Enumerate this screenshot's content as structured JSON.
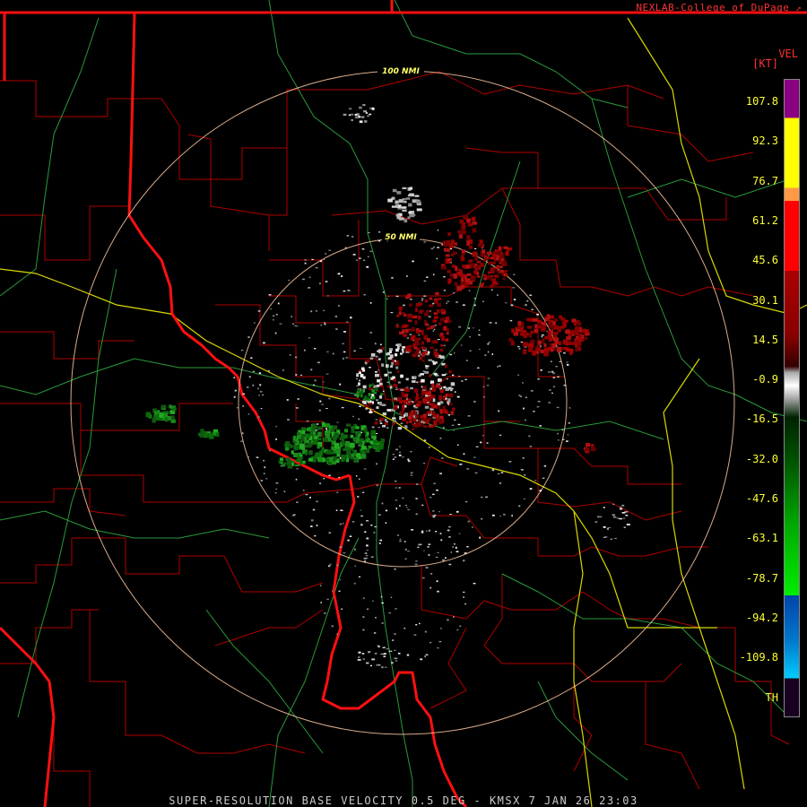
{
  "credit": "NEXLAB-College of DuPage",
  "footer": "SUPER-RESOLUTION BASE VELOCITY 0.5 DEG - KMSX 7 JAN 26 23:03",
  "legend": {
    "title": "VEL",
    "unit": "[KT]",
    "labels": [
      "107.8",
      "92.3",
      "76.7",
      "61.2",
      "45.6",
      "30.1",
      "14.5",
      "-0.9",
      "-16.5",
      "-32.0",
      "-47.6",
      "-63.1",
      "-78.7",
      "-94.2",
      "-109.8",
      "TH"
    ],
    "colors": {
      "purple": "#8a0080",
      "yellow": "#ffff00",
      "orange": "#ff9944",
      "red": "#ff0000",
      "dark_red": "#8a0000",
      "gray": "#aaaaaa",
      "dark_green": "#005500",
      "green": "#00ee00",
      "blue": "#0044aa",
      "cyan": "#00ccff",
      "th": "#1a0020"
    }
  },
  "rings": [
    {
      "label": "50 NMI"
    },
    {
      "label": "100 NMI"
    }
  ]
}
